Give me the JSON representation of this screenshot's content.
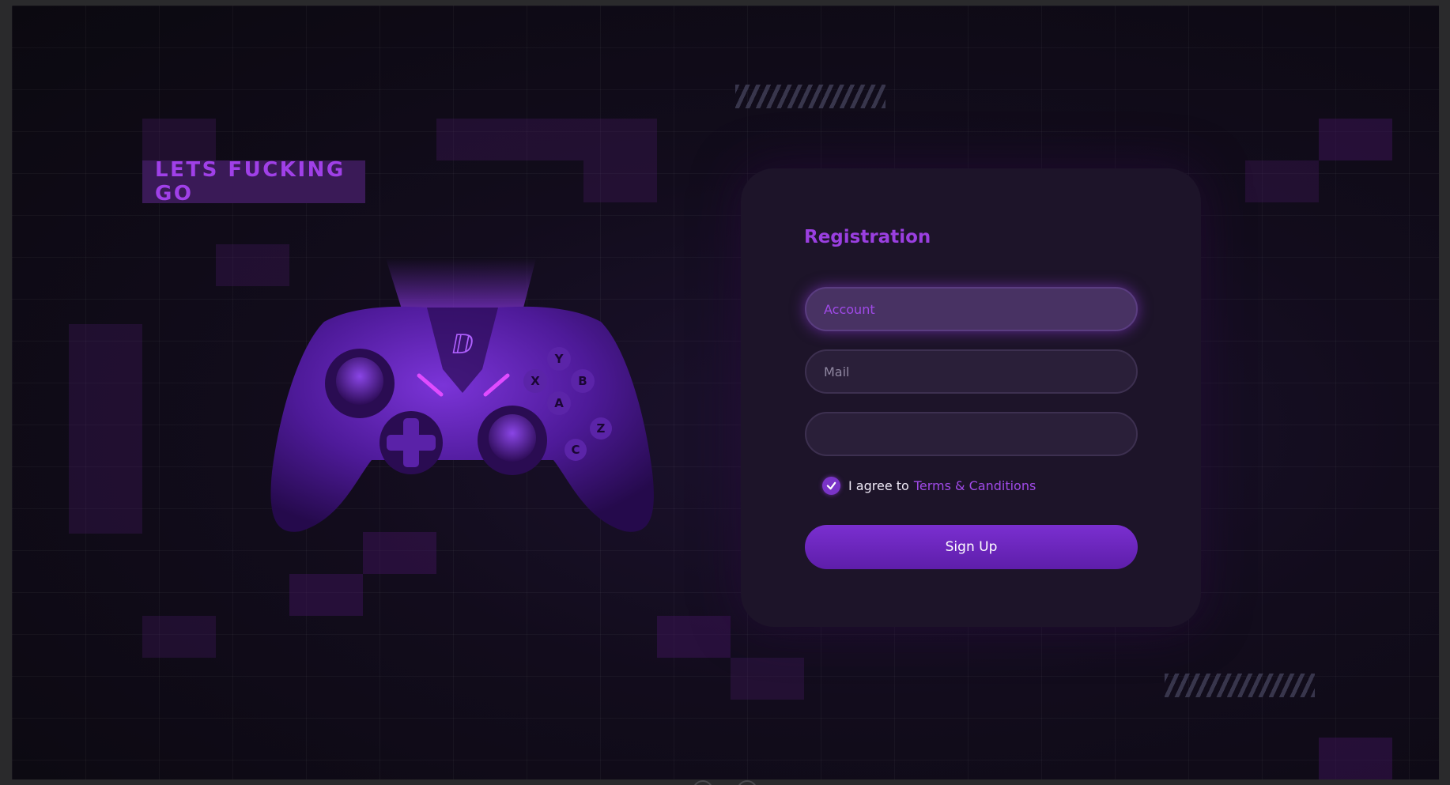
{
  "hero": {
    "badge_text": "LETS FUCKING GO"
  },
  "registration": {
    "title": "Registration",
    "account_placeholder": "Account",
    "mail_placeholder": "Mail",
    "password_placeholder": "",
    "agree_text": "I agree to",
    "terms_link": "Terms & Canditions",
    "terms_checked": true,
    "submit_label": "Sign Up"
  },
  "icons": {
    "controller": "gamepad-illustration",
    "check": "check-icon"
  },
  "colors": {
    "accent": "#9a3fe0",
    "button": "#6a24bd",
    "card": "#1d1429",
    "background": "#120c1c"
  }
}
